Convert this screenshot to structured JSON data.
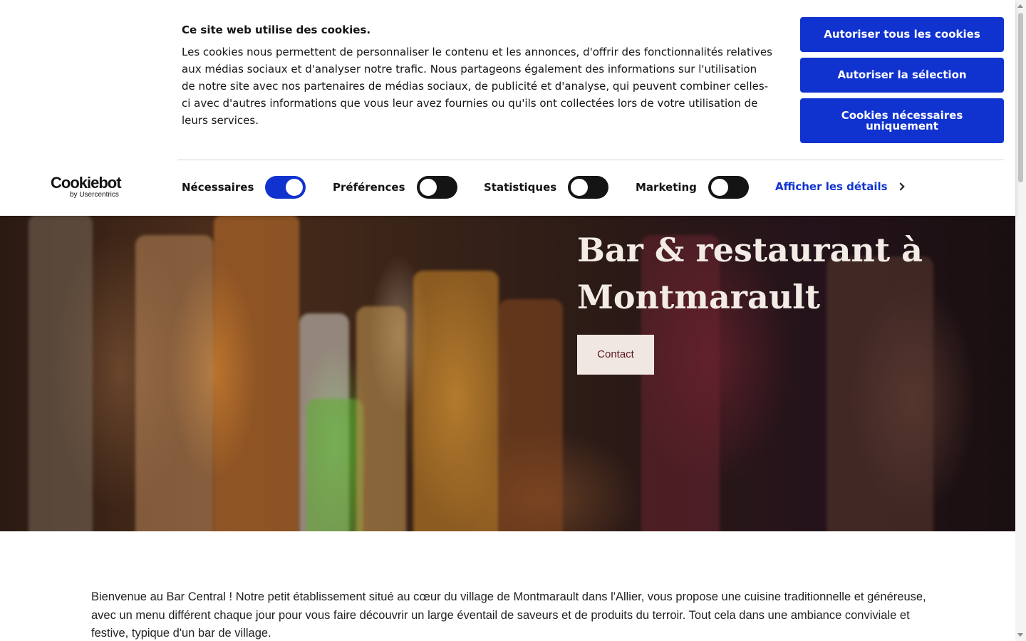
{
  "cookie_banner": {
    "title": "Ce site web utilise des cookies.",
    "text": "Les cookies nous permettent de personnaliser le contenu et les annonces, d'offrir des fonctionnalités relatives aux médias sociaux et d'analyser notre trafic. Nous partageons également des informations sur l'utilisation de notre site avec nos partenaires de médias sociaux, de publicité et d'analyse, qui peuvent combiner celles-ci avec d'autres informations que vous leur avez fournies ou qu'ils ont collectées lors de votre utilisation de leurs services.",
    "buttons": {
      "allow_all": "Autoriser tous les cookies",
      "allow_selection": "Autoriser la sélection",
      "necessary_only": "Cookies nécessaires uniquement"
    },
    "logo": {
      "word": "Cookiebot",
      "sub": "by Usercentrics"
    },
    "toggles": [
      {
        "label": "Nécessaires",
        "state": "on"
      },
      {
        "label": "Préférences",
        "state": "off"
      },
      {
        "label": "Statistiques",
        "state": "off"
      },
      {
        "label": "Marketing",
        "state": "off"
      }
    ],
    "details_link": "Afficher les détails",
    "accent_color": "#1032cf"
  },
  "hero": {
    "title": "Bar & restaurant à Montmarault",
    "contact_button": "Contact"
  },
  "intro": {
    "text": "Bienvenue au Bar Central ! Notre petit établissement situé au cœur du village de Montmarault dans l'Allier, vous propose une cuisine traditionnelle et généreuse, avec un menu différent chaque jour pour vous faire découvrir un large éventail de saveurs et de produits du terroir. Tout cela dans une ambiance conviviale et festive, typique d'un bar de village."
  }
}
